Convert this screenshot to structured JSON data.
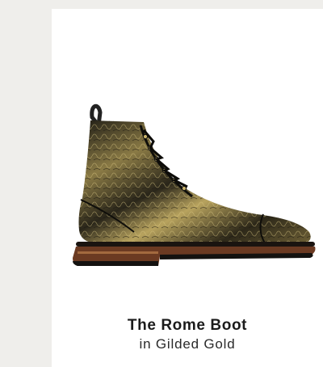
{
  "product": {
    "name": "The Rome Boot",
    "variant": "in Gilded Gold",
    "image_icon": "boot-image"
  },
  "colors": {
    "page_background": "#efeeeb",
    "card_background": "#ffffff",
    "title_text": "#1b1b1b"
  }
}
